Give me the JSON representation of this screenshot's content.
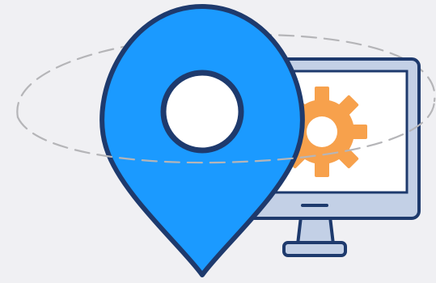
{
  "scene": {
    "background_color": "#f0f0f3",
    "outline_color": "#1e3a6d",
    "pin_color": "#1b9aff",
    "gear_color": "#f7a14c",
    "monitor_frame_color": "#c3d0e6",
    "screen_color": "#ffffff",
    "dashed_orbit_color": "#b5b5b8",
    "icons": [
      "location-pin-icon",
      "monitor-icon",
      "gear-icon"
    ]
  }
}
